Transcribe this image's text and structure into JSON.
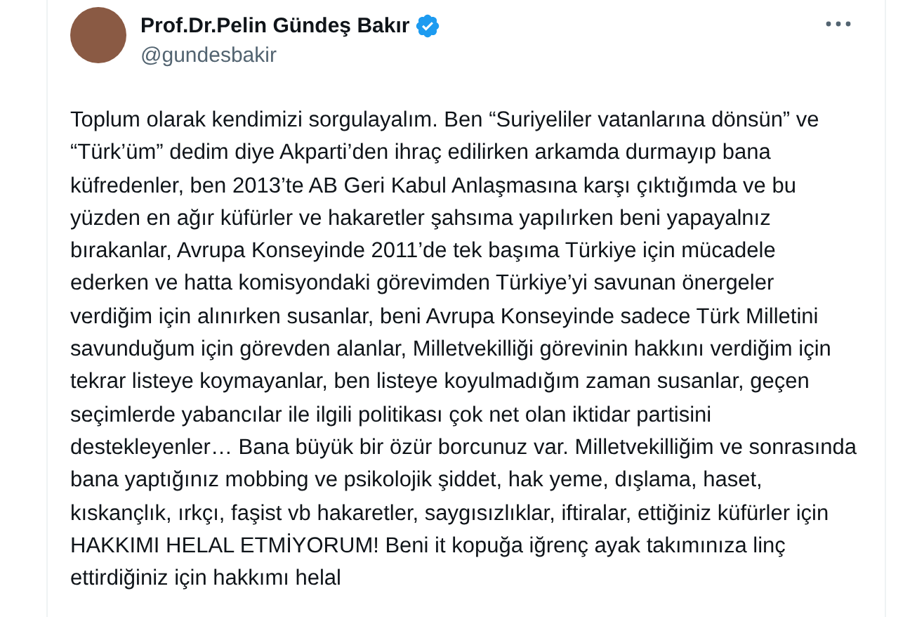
{
  "author": {
    "name": "Prof.Dr.Pelin Gündeş Bakır",
    "verified": true,
    "handle": "@gundesbakir"
  },
  "tweet": {
    "text": "Toplum olarak kendimizi sorgulayalım. Ben “Suriyeliler vatanlarına dönsün” ve “Türk’üm” dedim diye Akparti’den ihraç edilirken arkamda durmayıp bana küfredenler, ben 2013’te AB Geri Kabul Anlaşmasına karşı çıktığımda ve bu yüzden en ağır küfürler ve hakaretler şahsıma yapılırken beni yapayalnız bırakanlar, Avrupa Konseyinde 2011’de tek başıma Türkiye için mücadele ederken ve hatta komisyondaki görevimden Türkiye’yi savunan önergeler verdiğim için alınırken susanlar, beni Avrupa Konseyinde sadece Türk Milletini savunduğum için görevden alanlar, Milletvekilliği görevinin hakkını verdiğim için tekrar listeye koymayanlar, ben listeye koyulmadığım zaman susanlar, geçen seçimlerde yabancılar ile ilgili politikası çok net olan iktidar partisini destekleyenler… Bana büyük bir özür borcunuz var. Milletvekilliğim ve sonrasında bana yaptığınız mobbing ve psikolojik şiddet, hak yeme, dışlama, haset, kıskançlık, ırkçı, faşist vb hakaretler, saygısızlıklar, iftiralar, ettiğiniz küfürler için HAKKIMI HELAL ETMİYORUM! Beni it kopuğa iğrenç ayak takımınıza linç ettirdiğiniz için hakkımı helal"
  }
}
